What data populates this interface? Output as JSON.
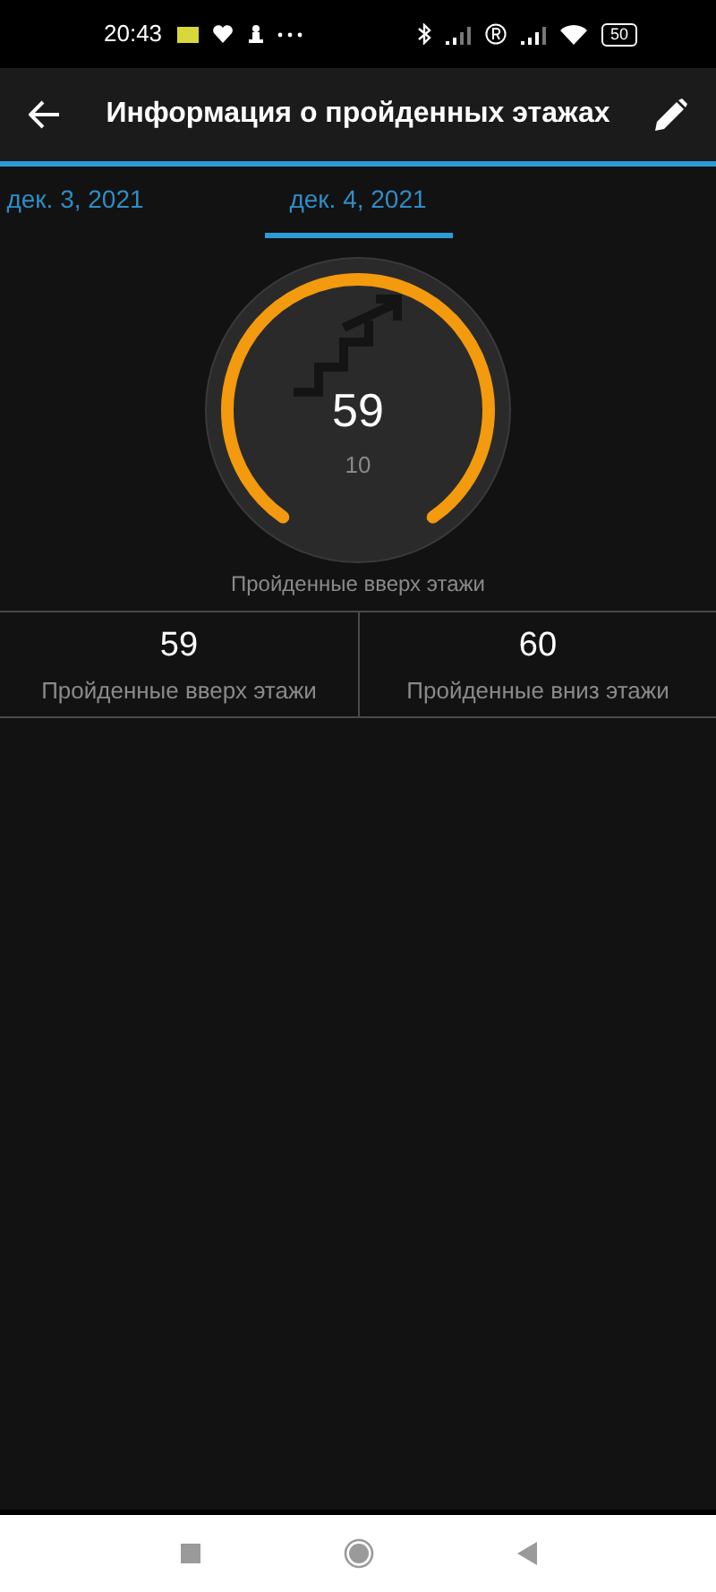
{
  "status_bar": {
    "time": "20:43",
    "battery": "50"
  },
  "header": {
    "title": "Информация о пройденных этажах"
  },
  "tabs": [
    {
      "label": "дек. 3, 2021",
      "selected": false
    },
    {
      "label": "дек. 4, 2021",
      "selected": true
    }
  ],
  "gauge": {
    "value": "59",
    "goal": "10",
    "caption": "Пройденные вверх этажи"
  },
  "stats": [
    {
      "value": "59",
      "label": "Пройденные вверх этажи"
    },
    {
      "value": "60",
      "label": "Пройденные вниз этажи"
    }
  ]
}
